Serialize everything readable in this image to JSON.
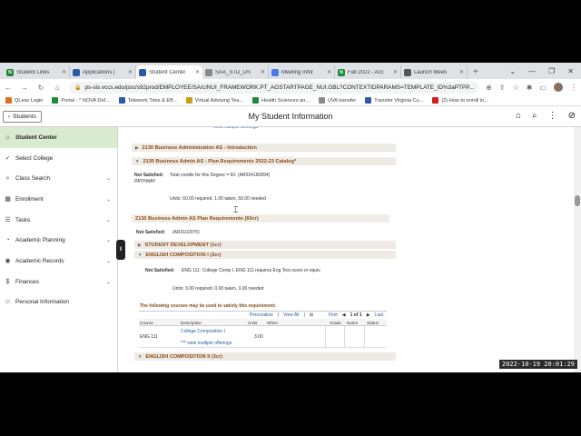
{
  "browser": {
    "tabs": [
      {
        "label": "Student Links",
        "fav": "N",
        "color": "#1d8a3a"
      },
      {
        "label": "Applications |",
        "fav": "",
        "color": "#2a5aa8"
      },
      {
        "label": "Student Center",
        "fav": "",
        "color": "#2a5aa8",
        "active": true
      },
      {
        "label": "SAA_STD_DS",
        "fav": "",
        "color": "#888888"
      },
      {
        "label": "Meeting Infor",
        "fav": "",
        "color": "#4a7ae8"
      },
      {
        "label": "Fall 2022 - Acc",
        "fav": "N",
        "color": "#1d8a3a"
      },
      {
        "label": "Launch Meeti",
        "fav": "",
        "color": "#555555"
      }
    ],
    "url": "ps-sis.vccs.edu/psc/s92prod/EMPLOYEE/SA/c/NUI_FRAMEWORK.PT_AGSTARTPAGE_NUI.GBL?CONTEXTIDPARAMS=TEMPLATE_ID%3aPTPP...",
    "bookmarks": [
      {
        "label": "QLess Login",
        "color": "#e0701a"
      },
      {
        "label": "Portal - * NOVA Def...",
        "color": "#1d8a3a"
      },
      {
        "label": "Telework Time & Eff...",
        "color": "#2a5aa8"
      },
      {
        "label": "Virtual Advising Tea...",
        "color": "#c4a01a"
      },
      {
        "label": "Health Sciences an...",
        "color": "#1d8a3a"
      },
      {
        "label": "UVA transfer",
        "color": "#8a8a8a"
      },
      {
        "label": "Transfer Virginia Cu...",
        "color": "#2a5aa8"
      },
      {
        "label": "(2) How to enroll in...",
        "color": "#d02020"
      }
    ]
  },
  "app": {
    "back_label": "Students",
    "title": "My Student Information"
  },
  "sidebar": {
    "items": [
      {
        "label": "Student Center",
        "icon": "home-icon",
        "active": true,
        "chev": false
      },
      {
        "label": "Select College",
        "icon": "check-icon",
        "chev": false
      },
      {
        "label": "Class Search",
        "icon": "search-icon",
        "chev": true
      },
      {
        "label": "Enrollment",
        "icon": "calendar-icon",
        "chev": true
      },
      {
        "label": "Tasks",
        "icon": "tasks-icon",
        "chev": true
      },
      {
        "label": "Academic Planning",
        "icon": "planning-icon",
        "chev": true
      },
      {
        "label": "Academic Records",
        "icon": "records-icon",
        "chev": true
      },
      {
        "label": "Finances",
        "icon": "finances-icon",
        "chev": true
      },
      {
        "label": "Personal Information",
        "icon": "person-icon",
        "chev": false
      }
    ]
  },
  "main": {
    "sec1": "2130 Business Administration AS - Introduction",
    "sec2": "2130 Business Admin AS - Plan Requirements 2022-23 Catalog*",
    "not_satisfied": "Not Satisfied:",
    "total_credits": "Total credits for this Degree = 60. (AR034160894)",
    "pathway": "PATHWAY",
    "units_line1": "Units: 60.00 required, 1.00 taken, 59.00 needed",
    "sec3": "2130 Business Admin AS Plan Requirements (60cr)",
    "ar_code": "(AR3102070)",
    "student_dev": "STUDENT DEVELOPMENT (1cr)",
    "eng_comp1": "ENGLISH COMPOSITION I (3cr)",
    "eng_req": "ENG 111: College Comp I. ENG 111 requires Eng Test score or equiv.",
    "units_line2": "Units: 3.00 required, 0.00 taken, 3.00 needed",
    "following": "The following courses may be used to satisfy this requirement:",
    "grid_nav": {
      "personalize": "Personalize",
      "view_all": "View All",
      "first": "First",
      "range": "1 of 1",
      "last": "Last"
    },
    "cols": {
      "course": "Course",
      "description": "Description",
      "units": "Units",
      "when": "When",
      "grade": "Grade",
      "notes": "Notes",
      "status": "Status"
    },
    "row": {
      "course": "ENG 111",
      "description": "College Composition I",
      "units": "3.00",
      "more": "*** view multiple offerings"
    },
    "eng_comp2": "ENGLISH COMPOSITION II (3cr)"
  },
  "timestamp": "2022-10-19 20:01:29"
}
